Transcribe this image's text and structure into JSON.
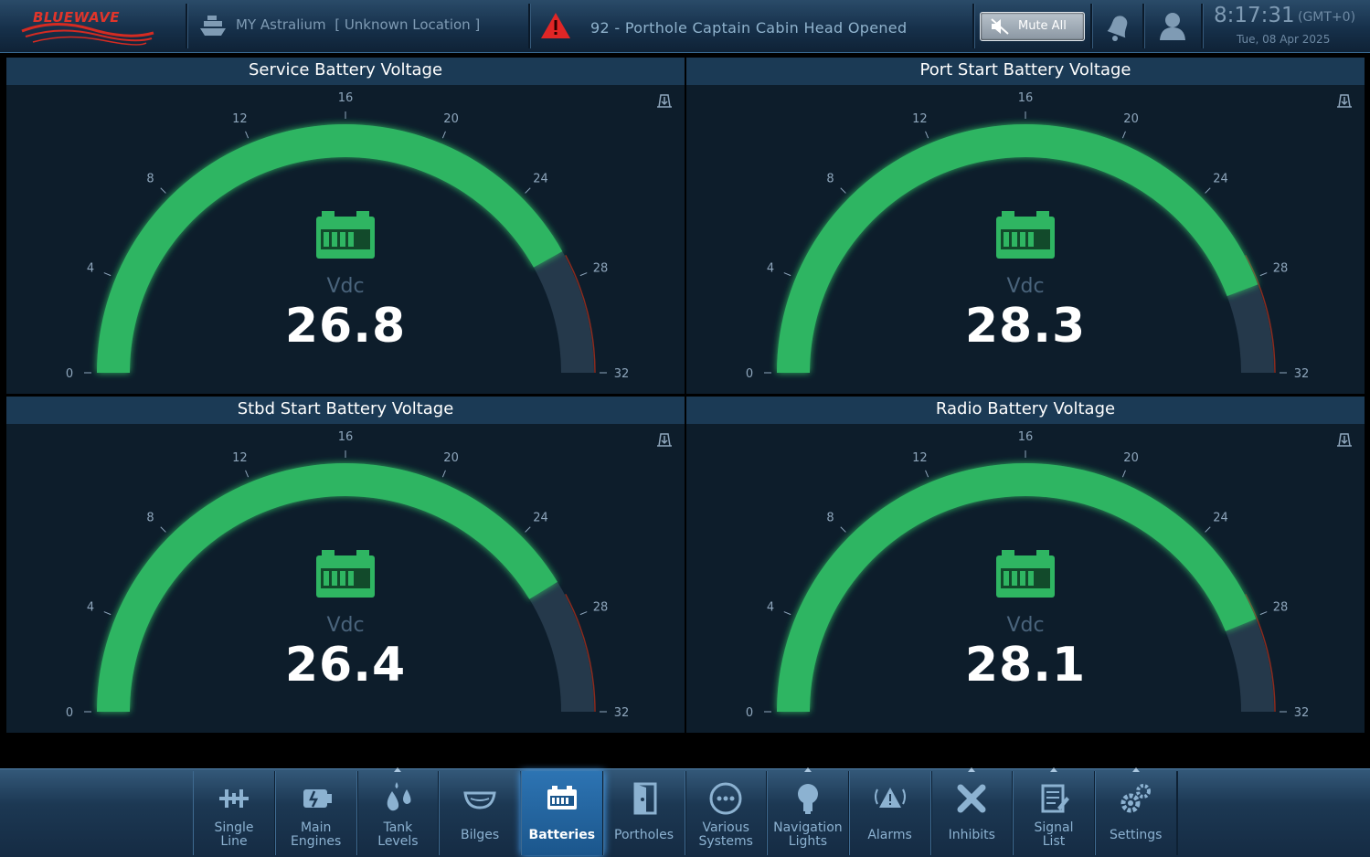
{
  "header": {
    "logo": "BLUEWAVE",
    "vessel": "MY Astralium",
    "location": "[ Unknown Location ]",
    "alarm_code": "92",
    "alarm_text": "Porthole Captain Cabin Head Opened",
    "mute_label": "Mute All",
    "time": "8:17:31",
    "timezone": "(GMT+0)",
    "date": "Tue, 08 Apr 2025"
  },
  "gauge_scale": {
    "min": 0,
    "max": 32,
    "ticks": [
      "0",
      "4",
      "8",
      "12",
      "16",
      "20",
      "24",
      "28",
      "32"
    ]
  },
  "gauges": [
    {
      "title": "Service Battery Voltage",
      "unit": "Vdc",
      "value": 26.8,
      "display": "26.8"
    },
    {
      "title": "Port Start Battery Voltage",
      "unit": "Vdc",
      "value": 28.3,
      "display": "28.3"
    },
    {
      "title": "Stbd Start Battery Voltage",
      "unit": "Vdc",
      "value": 26.4,
      "display": "26.4"
    },
    {
      "title": "Radio Battery Voltage",
      "unit": "Vdc",
      "value": 28.1,
      "display": "28.1"
    }
  ],
  "colors": {
    "gauge_fill": "#2fb562",
    "gauge_track": "#25394b",
    "accent": "#2d74b3"
  },
  "nav": {
    "items": [
      {
        "label": "Single Line",
        "icon": "single-line-icon"
      },
      {
        "label": "Main Engines",
        "icon": "engine-icon"
      },
      {
        "label": "Tank Levels",
        "icon": "tank-drops-icon"
      },
      {
        "label": "Bilges",
        "icon": "bilge-icon"
      },
      {
        "label": "Batteries",
        "icon": "battery-icon",
        "active": true
      },
      {
        "label": "Portholes",
        "icon": "porthole-door-icon"
      },
      {
        "label": "Various Systems",
        "icon": "ellipsis-icon"
      },
      {
        "label": "Navigation Lights",
        "icon": "light-bulb-icon"
      },
      {
        "label": "Alarms",
        "icon": "alarm-icon"
      },
      {
        "label": "Inhibits",
        "icon": "inhibit-x-icon"
      },
      {
        "label": "Signal List",
        "icon": "signal-list-icon"
      },
      {
        "label": "Settings",
        "icon": "gears-icon"
      }
    ]
  }
}
